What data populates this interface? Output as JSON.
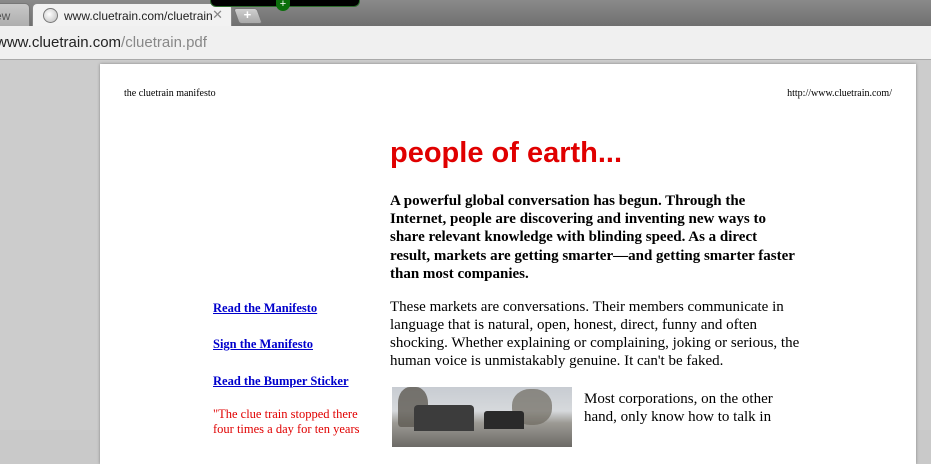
{
  "browser": {
    "inactive_tab_label": "ew",
    "active_tab_title": "www.cluetrain.com/cluetrain.pdf",
    "tab_close_glyph": "✕",
    "new_tab_glyph": "+",
    "extension_glyph": "+",
    "address": {
      "domain": "www.cluetrain.com",
      "path": "/cluetrain.pdf"
    }
  },
  "page": {
    "header_left": "the cluetrain manifesto",
    "header_right": "http://www.cluetrain.com/",
    "headline": "people of earth...",
    "lead": "A powerful global conversation has begun. Through the Internet, people are discovering and inventing new ways to share relevant knowledge with blinding speed. As a direct result, markets are getting smarter—and getting smarter faster than most companies.",
    "paragraph1": "These markets are conversations. Their members communicate in language that is natural, open, honest, direct, funny and often shocking. Whether explaining or complaining, joking or serious, the human voice is unmistakably genuine. It can't be faked.",
    "paragraph2": "Most corporations, on the other hand, only know how to talk in",
    "side_links": [
      {
        "label": "Read the Manifesto"
      },
      {
        "label": "Sign the Manifesto"
      },
      {
        "label": "Read the Bumper Sticker"
      }
    ],
    "quote": "\"The clue train stopped there four times a day for ten years"
  }
}
